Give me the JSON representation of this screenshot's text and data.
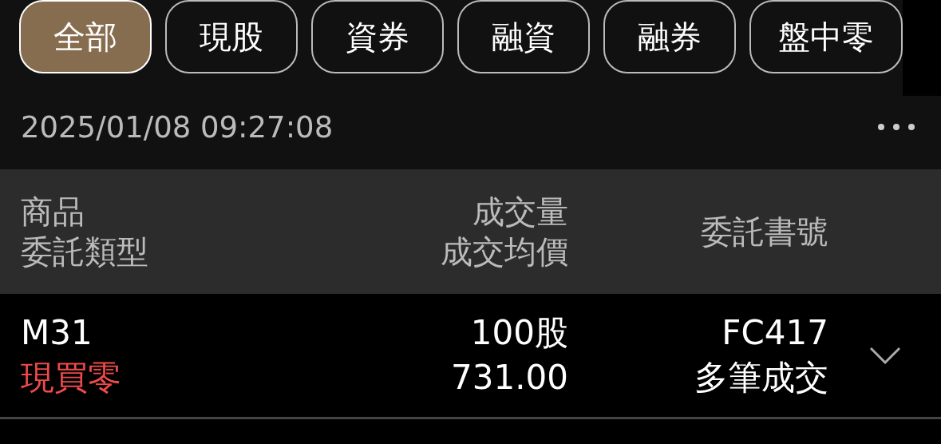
{
  "tabs": [
    {
      "label": "全部",
      "selected": true
    },
    {
      "label": "現股",
      "selected": false
    },
    {
      "label": "資券",
      "selected": false
    },
    {
      "label": "融資",
      "selected": false
    },
    {
      "label": "融券",
      "selected": false
    },
    {
      "label": "盤中零",
      "selected": false
    }
  ],
  "timestamp": "2025/01/08 09:27:08",
  "table": {
    "columns": [
      {
        "lines": [
          "商品",
          "委託類型"
        ]
      },
      {
        "lines": [
          "成交量",
          "成交均價"
        ]
      },
      {
        "lines": [
          "委託書號"
        ]
      }
    ],
    "rows": [
      {
        "symbol": "M31",
        "order_type": "現買零",
        "color": "#f04a4a",
        "quantity": "100股",
        "avg_price": "731.00",
        "order_no": "FC417",
        "fill_status": "多筆成交",
        "expanded": false
      }
    ]
  }
}
